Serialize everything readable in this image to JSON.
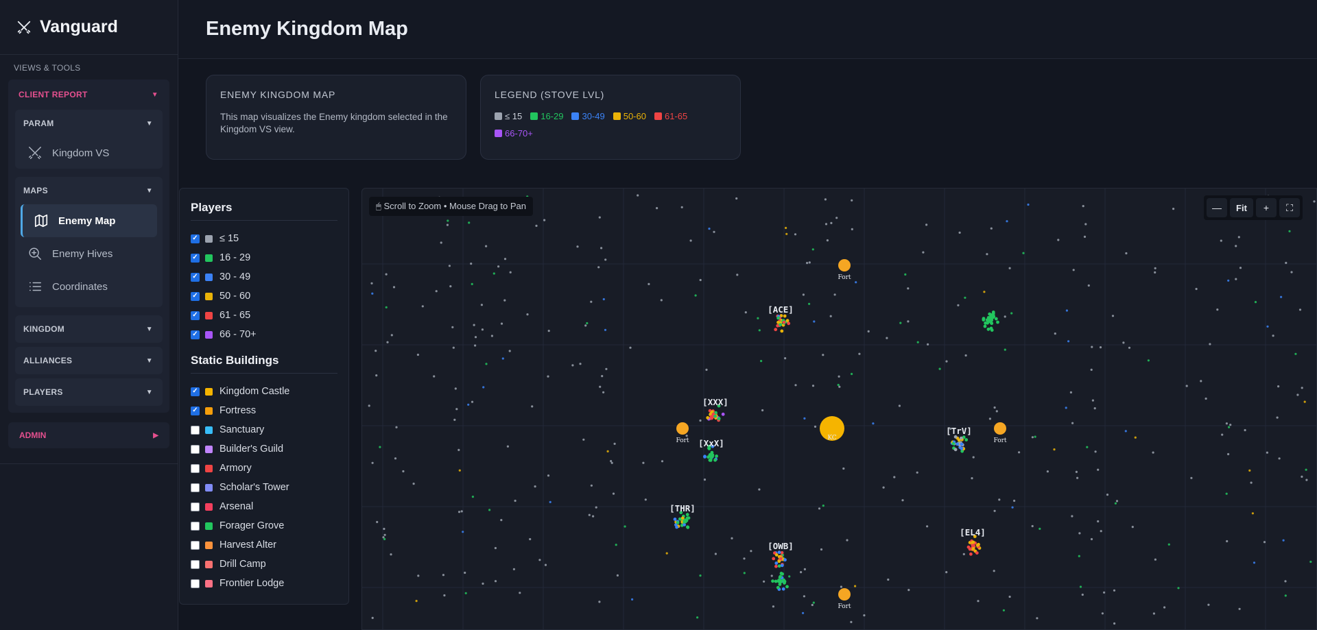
{
  "app": {
    "name": "Vanguard"
  },
  "sidebar": {
    "section_label": "VIEWS & TOOLS",
    "client_report": "CLIENT REPORT",
    "param": {
      "label": "PARAM",
      "items": [
        "Kingdom VS"
      ]
    },
    "maps": {
      "label": "MAPS",
      "items": [
        "Enemy Map",
        "Enemy Hives",
        "Coordinates"
      ]
    },
    "kingdom": "KINGDOM",
    "alliances": "ALLIANCES",
    "players": "PLAYERS",
    "admin": "ADMIN"
  },
  "page": {
    "title": "Enemy Kingdom Map"
  },
  "info_card": {
    "title": "ENEMY KINGDOM MAP",
    "text": "This map visualizes the Enemy kingdom selected in the Kingdom VS view."
  },
  "legend": {
    "title": "LEGEND (STOVE LVL)",
    "items": [
      {
        "label": "≤ 15",
        "color": "#9ca3af"
      },
      {
        "label": "16-29",
        "color": "#22c55e"
      },
      {
        "label": "30-49",
        "color": "#3b82f6"
      },
      {
        "label": "50-60",
        "color": "#eab308"
      },
      {
        "label": "61-65",
        "color": "#ef4444"
      },
      {
        "label": "66-70+",
        "color": "#a855f7"
      }
    ]
  },
  "filters": {
    "players_title": "Players",
    "players": [
      {
        "label": "≤ 15",
        "color": "#9ca3af",
        "checked": true
      },
      {
        "label": "16 - 29",
        "color": "#22c55e",
        "checked": true
      },
      {
        "label": "30 - 49",
        "color": "#3b82f6",
        "checked": true
      },
      {
        "label": "50 - 60",
        "color": "#eab308",
        "checked": true
      },
      {
        "label": "61 - 65",
        "color": "#ef4444",
        "checked": true
      },
      {
        "label": "66 - 70+",
        "color": "#a855f7",
        "checked": true
      }
    ],
    "buildings_title": "Static Buildings",
    "buildings": [
      {
        "label": "Kingdom Castle",
        "color": "#f5b400",
        "checked": true
      },
      {
        "label": "Fortress",
        "color": "#f59e0b",
        "checked": true
      },
      {
        "label": "Sanctuary",
        "color": "#38bdf8",
        "checked": false
      },
      {
        "label": "Builder's Guild",
        "color": "#c084fc",
        "checked": false
      },
      {
        "label": "Armory",
        "color": "#ef4444",
        "checked": false
      },
      {
        "label": "Scholar's Tower",
        "color": "#818cf8",
        "checked": false
      },
      {
        "label": "Arsenal",
        "color": "#f43f5e",
        "checked": false
      },
      {
        "label": "Forager Grove",
        "color": "#22c55e",
        "checked": false
      },
      {
        "label": "Harvest Alter",
        "color": "#fb923c",
        "checked": false
      },
      {
        "label": "Drill Camp",
        "color": "#f87171",
        "checked": false
      },
      {
        "label": "Frontier Lodge",
        "color": "#fb7185",
        "checked": false
      }
    ]
  },
  "map": {
    "hint": "Scroll to Zoom • Mouse Drag to Pan",
    "controls": {
      "zoom_out": "—",
      "fit": "Fit",
      "zoom_in": "+",
      "fullscreen": "⛶"
    },
    "fort_label": "Fort",
    "castle_label": "KC",
    "alliances": [
      "[ACE]",
      "[XXX]",
      "[XxX]",
      "[TrV]",
      "[THR]",
      "[OWB]",
      "[EL4]"
    ]
  }
}
